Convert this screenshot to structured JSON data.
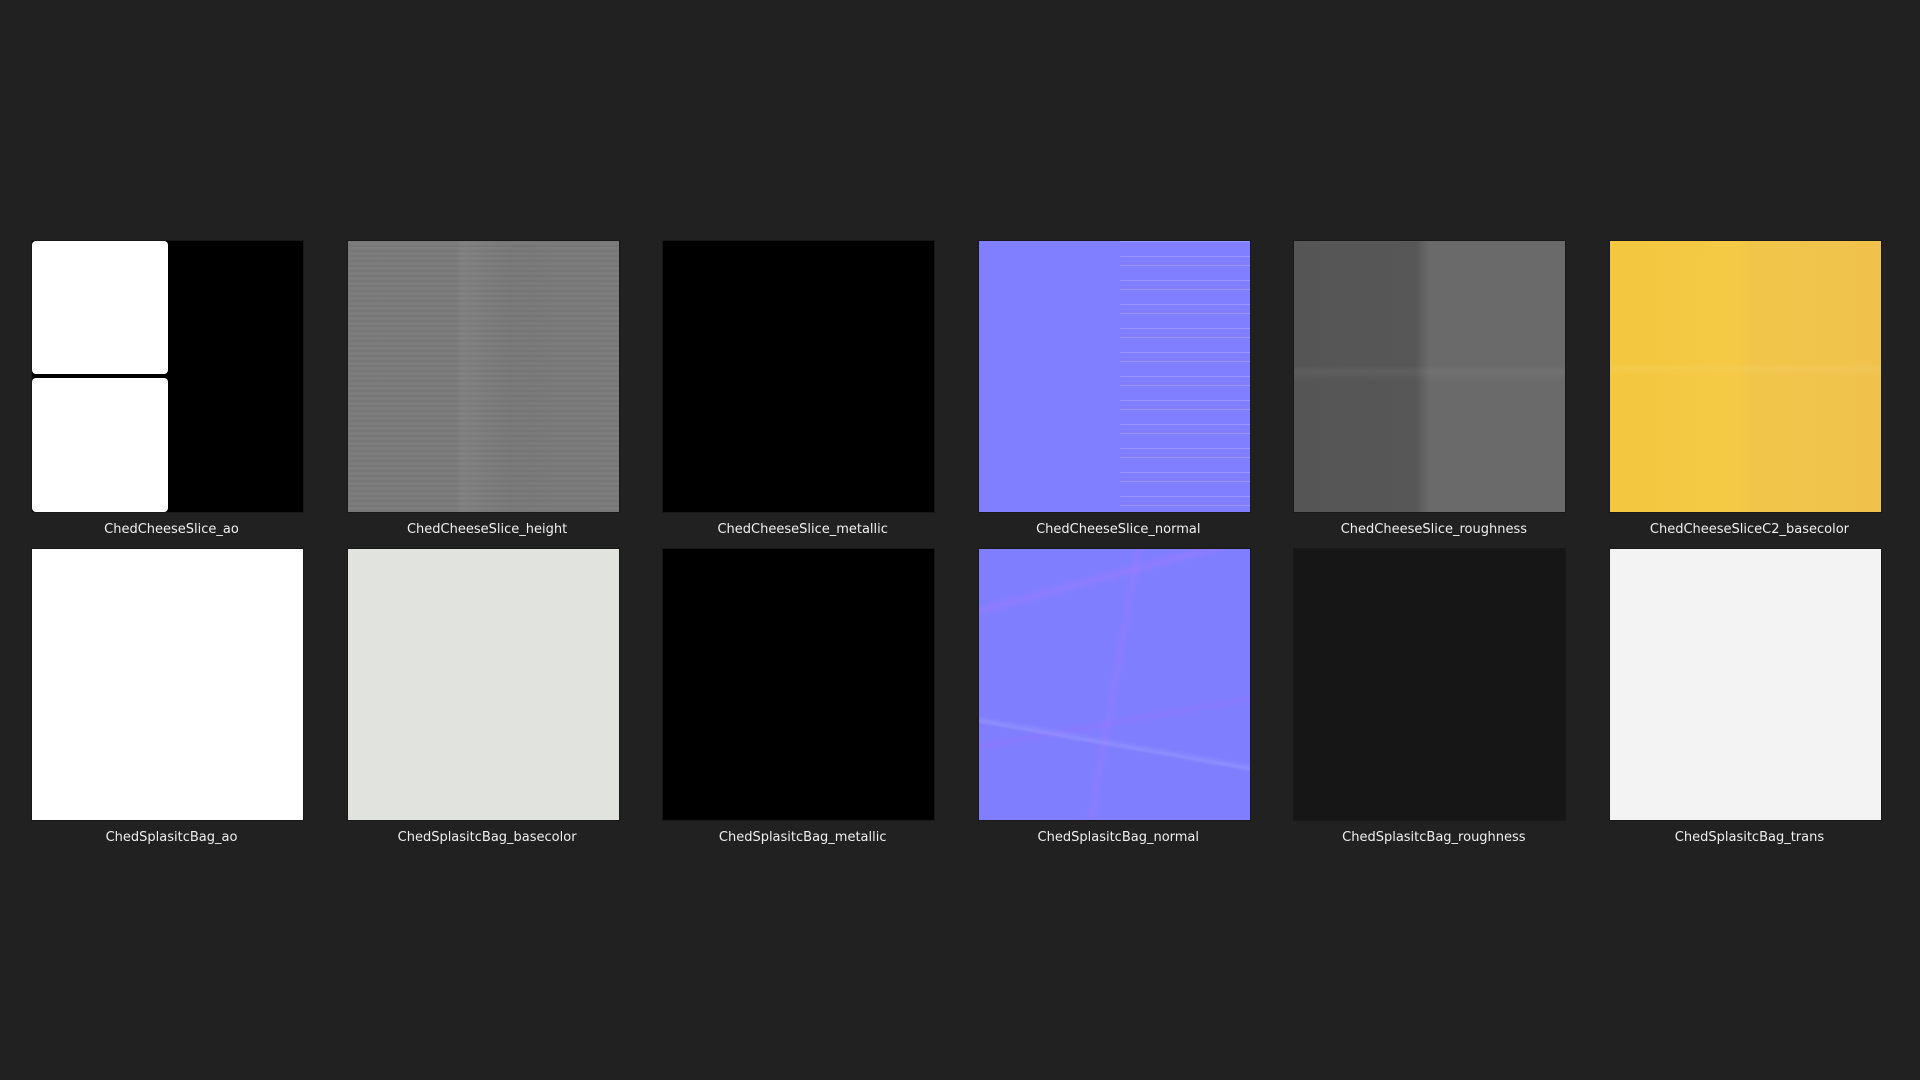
{
  "items": [
    {
      "label": "ChedCheeseSlice_ao"
    },
    {
      "label": "ChedCheeseSlice_height"
    },
    {
      "label": "ChedCheeseSlice_metallic"
    },
    {
      "label": "ChedCheeseSlice_normal"
    },
    {
      "label": "ChedCheeseSlice_roughness"
    },
    {
      "label": "ChedCheeseSliceC2_basecolor"
    },
    {
      "label": "ChedSplasitcBag_ao"
    },
    {
      "label": "ChedSplasitcBag_basecolor"
    },
    {
      "label": "ChedSplasitcBag_metallic"
    },
    {
      "label": "ChedSplasitcBag_normal"
    },
    {
      "label": "ChedSplasitcBag_roughness"
    },
    {
      "label": "ChedSplasitcBag_trans"
    }
  ]
}
